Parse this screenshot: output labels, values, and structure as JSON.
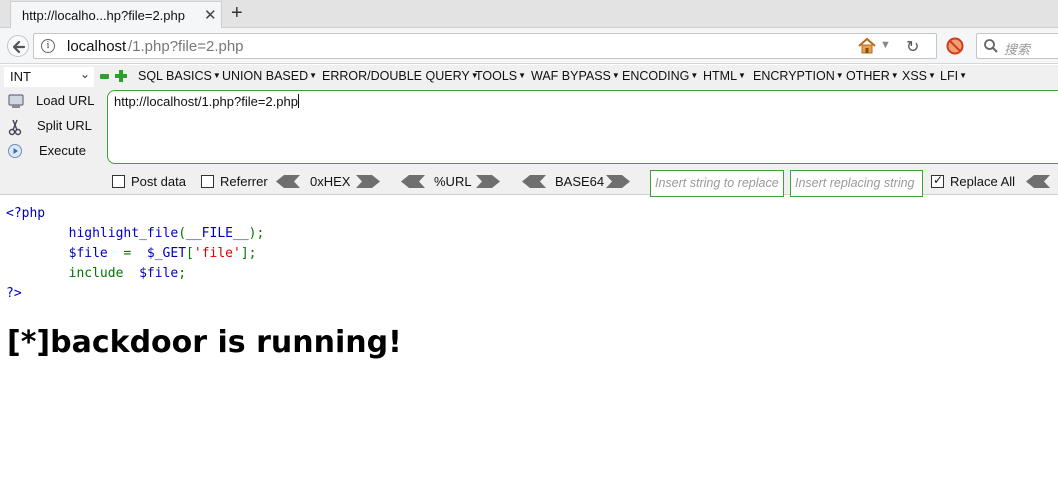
{
  "browser": {
    "tab_title": "http://localho...hp?file=2.php",
    "tab_close": "✕",
    "new_tab": "+",
    "url_host": "localhost",
    "url_path": "/1.php?file=2.php",
    "search_placeholder": "搜索"
  },
  "hackbar": {
    "type_select": "INT",
    "menus": [
      "SQL BASICS",
      "UNION BASED",
      "ERROR/DOUBLE QUERY",
      "TOOLS",
      "WAF BYPASS",
      "ENCODING",
      "HTML",
      "ENCRYPTION",
      "OTHER",
      "XSS",
      "LFI"
    ],
    "load_url": "Load URL",
    "split_url": "Split URL",
    "execute": "Execute",
    "url_value": "http://localhost/1.php?file=2.php",
    "post_data": "Post data",
    "referrer": "Referrer",
    "enc_hex": "0xHEX",
    "enc_url": "%URL",
    "enc_base64": "BASE64",
    "insert_placeholder": "Insert string to replace",
    "replacing_placeholder": "Insert replacing string",
    "replace_all": "Replace All",
    "post_data_checked": false,
    "referrer_checked": false,
    "replace_all_checked": true,
    "accent_color": "#3aa23a"
  },
  "page": {
    "code": {
      "open_tag": "<?php",
      "fn_name": "highlight_file",
      "fn_open": "(",
      "fn_arg": "__FILE__",
      "fn_close": ");",
      "var_file": "$file",
      "assign": "=",
      "get_var": "$_GET",
      "bracket_open": "[",
      "key": "'file'",
      "bracket_close": "];",
      "include_kw": "include",
      "include_var": "$file",
      "semi": ";",
      "close_tag": "?>"
    },
    "heading": "[*]backdoor is running!"
  }
}
